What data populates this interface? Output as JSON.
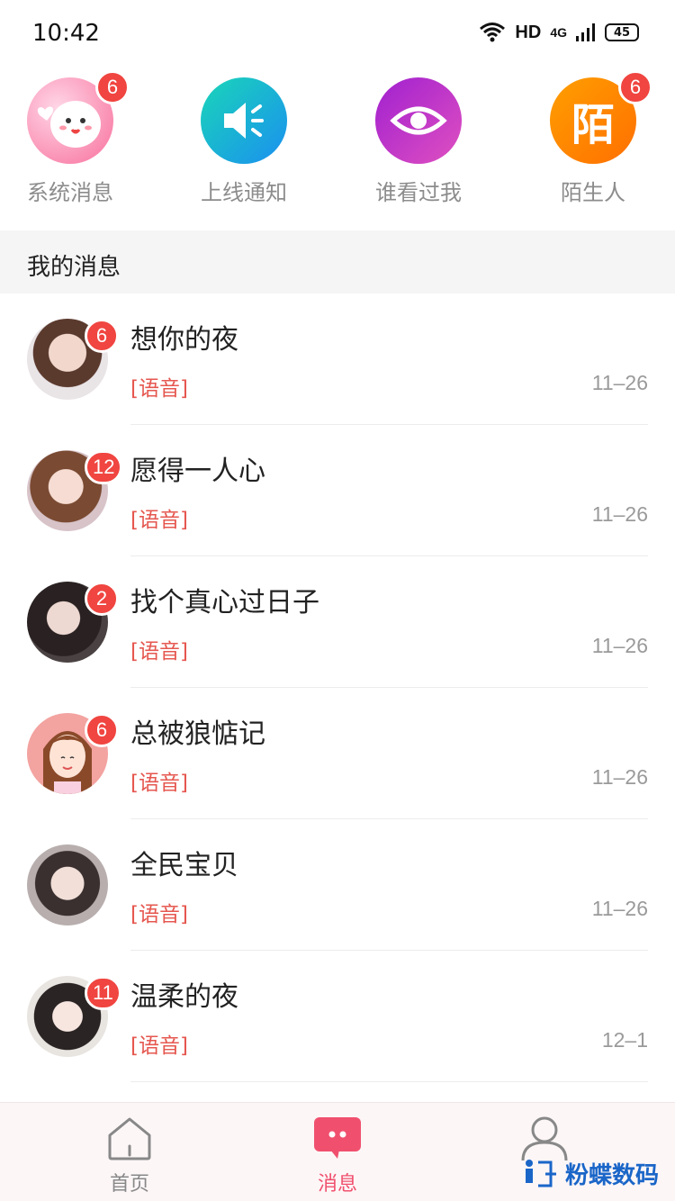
{
  "status_bar": {
    "time": "10:42",
    "network": "HD",
    "cell": "4G",
    "battery": "45"
  },
  "quick_entries": [
    {
      "label": "系统消息",
      "badge": "6",
      "icon": "cute-face-icon",
      "color": "#f86f9c"
    },
    {
      "label": "上线通知",
      "badge": "",
      "icon": "speaker-icon",
      "color": "#19b6d9"
    },
    {
      "label": "谁看过我",
      "badge": "",
      "icon": "eye-icon",
      "color": "#b42ccd"
    },
    {
      "label": "陌生人",
      "badge": "6",
      "icon": "stranger-icon",
      "glyph": "陌",
      "color": "#ff8a00"
    }
  ],
  "section_title": "我的消息",
  "messages": [
    {
      "name": "想你的夜",
      "preview": "[语音]",
      "time": "11–26",
      "badge": "6",
      "avatar_color": "#c9a89c"
    },
    {
      "name": "愿得一人心",
      "preview": "[语音]",
      "time": "11–26",
      "badge": "12",
      "avatar_color": "#b0805e"
    },
    {
      "name": "找个真心过日子",
      "preview": "[语音]",
      "time": "11–26",
      "badge": "2",
      "avatar_color": "#3b3030"
    },
    {
      "name": "总被狼惦记",
      "preview": "[语音]",
      "time": "11–26",
      "badge": "6",
      "avatar_color": "#f3a3a0"
    },
    {
      "name": "全民宝贝",
      "preview": "[语音]",
      "time": "11–26",
      "badge": "",
      "avatar_color": "#a89e9e"
    },
    {
      "name": "温柔的夜",
      "preview": "[语音]",
      "time": "12–1",
      "badge": "11",
      "avatar_color": "#5a4a48"
    }
  ],
  "tabs": [
    {
      "label": "首页",
      "icon": "home-icon",
      "active": false
    },
    {
      "label": "消息",
      "icon": "message-icon",
      "active": true
    },
    {
      "label": "",
      "icon": "profile-icon",
      "active": false
    }
  ],
  "watermark": "粉蝶数码"
}
